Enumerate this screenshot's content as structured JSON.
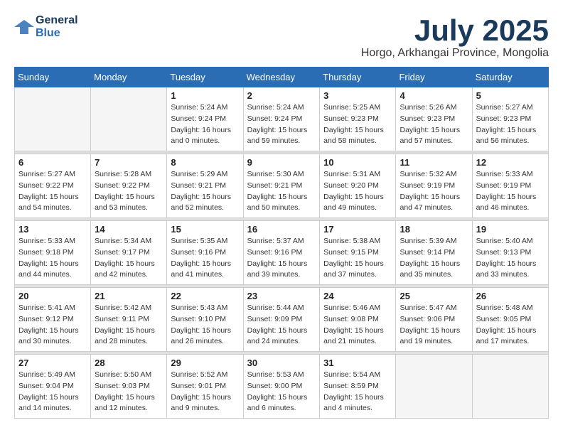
{
  "logo": {
    "line1": "General",
    "line2": "Blue"
  },
  "title": "July 2025",
  "location": "Horgo, Arkhangai Province, Mongolia",
  "days_of_week": [
    "Sunday",
    "Monday",
    "Tuesday",
    "Wednesday",
    "Thursday",
    "Friday",
    "Saturday"
  ],
  "weeks": [
    [
      {
        "day": "",
        "sunrise": "",
        "sunset": "",
        "daylight": ""
      },
      {
        "day": "",
        "sunrise": "",
        "sunset": "",
        "daylight": ""
      },
      {
        "day": "1",
        "sunrise": "Sunrise: 5:24 AM",
        "sunset": "Sunset: 9:24 PM",
        "daylight": "Daylight: 16 hours and 0 minutes."
      },
      {
        "day": "2",
        "sunrise": "Sunrise: 5:24 AM",
        "sunset": "Sunset: 9:24 PM",
        "daylight": "Daylight: 15 hours and 59 minutes."
      },
      {
        "day": "3",
        "sunrise": "Sunrise: 5:25 AM",
        "sunset": "Sunset: 9:23 PM",
        "daylight": "Daylight: 15 hours and 58 minutes."
      },
      {
        "day": "4",
        "sunrise": "Sunrise: 5:26 AM",
        "sunset": "Sunset: 9:23 PM",
        "daylight": "Daylight: 15 hours and 57 minutes."
      },
      {
        "day": "5",
        "sunrise": "Sunrise: 5:27 AM",
        "sunset": "Sunset: 9:23 PM",
        "daylight": "Daylight: 15 hours and 56 minutes."
      }
    ],
    [
      {
        "day": "6",
        "sunrise": "Sunrise: 5:27 AM",
        "sunset": "Sunset: 9:22 PM",
        "daylight": "Daylight: 15 hours and 54 minutes."
      },
      {
        "day": "7",
        "sunrise": "Sunrise: 5:28 AM",
        "sunset": "Sunset: 9:22 PM",
        "daylight": "Daylight: 15 hours and 53 minutes."
      },
      {
        "day": "8",
        "sunrise": "Sunrise: 5:29 AM",
        "sunset": "Sunset: 9:21 PM",
        "daylight": "Daylight: 15 hours and 52 minutes."
      },
      {
        "day": "9",
        "sunrise": "Sunrise: 5:30 AM",
        "sunset": "Sunset: 9:21 PM",
        "daylight": "Daylight: 15 hours and 50 minutes."
      },
      {
        "day": "10",
        "sunrise": "Sunrise: 5:31 AM",
        "sunset": "Sunset: 9:20 PM",
        "daylight": "Daylight: 15 hours and 49 minutes."
      },
      {
        "day": "11",
        "sunrise": "Sunrise: 5:32 AM",
        "sunset": "Sunset: 9:19 PM",
        "daylight": "Daylight: 15 hours and 47 minutes."
      },
      {
        "day": "12",
        "sunrise": "Sunrise: 5:33 AM",
        "sunset": "Sunset: 9:19 PM",
        "daylight": "Daylight: 15 hours and 46 minutes."
      }
    ],
    [
      {
        "day": "13",
        "sunrise": "Sunrise: 5:33 AM",
        "sunset": "Sunset: 9:18 PM",
        "daylight": "Daylight: 15 hours and 44 minutes."
      },
      {
        "day": "14",
        "sunrise": "Sunrise: 5:34 AM",
        "sunset": "Sunset: 9:17 PM",
        "daylight": "Daylight: 15 hours and 42 minutes."
      },
      {
        "day": "15",
        "sunrise": "Sunrise: 5:35 AM",
        "sunset": "Sunset: 9:16 PM",
        "daylight": "Daylight: 15 hours and 41 minutes."
      },
      {
        "day": "16",
        "sunrise": "Sunrise: 5:37 AM",
        "sunset": "Sunset: 9:16 PM",
        "daylight": "Daylight: 15 hours and 39 minutes."
      },
      {
        "day": "17",
        "sunrise": "Sunrise: 5:38 AM",
        "sunset": "Sunset: 9:15 PM",
        "daylight": "Daylight: 15 hours and 37 minutes."
      },
      {
        "day": "18",
        "sunrise": "Sunrise: 5:39 AM",
        "sunset": "Sunset: 9:14 PM",
        "daylight": "Daylight: 15 hours and 35 minutes."
      },
      {
        "day": "19",
        "sunrise": "Sunrise: 5:40 AM",
        "sunset": "Sunset: 9:13 PM",
        "daylight": "Daylight: 15 hours and 33 minutes."
      }
    ],
    [
      {
        "day": "20",
        "sunrise": "Sunrise: 5:41 AM",
        "sunset": "Sunset: 9:12 PM",
        "daylight": "Daylight: 15 hours and 30 minutes."
      },
      {
        "day": "21",
        "sunrise": "Sunrise: 5:42 AM",
        "sunset": "Sunset: 9:11 PM",
        "daylight": "Daylight: 15 hours and 28 minutes."
      },
      {
        "day": "22",
        "sunrise": "Sunrise: 5:43 AM",
        "sunset": "Sunset: 9:10 PM",
        "daylight": "Daylight: 15 hours and 26 minutes."
      },
      {
        "day": "23",
        "sunrise": "Sunrise: 5:44 AM",
        "sunset": "Sunset: 9:09 PM",
        "daylight": "Daylight: 15 hours and 24 minutes."
      },
      {
        "day": "24",
        "sunrise": "Sunrise: 5:46 AM",
        "sunset": "Sunset: 9:08 PM",
        "daylight": "Daylight: 15 hours and 21 minutes."
      },
      {
        "day": "25",
        "sunrise": "Sunrise: 5:47 AM",
        "sunset": "Sunset: 9:06 PM",
        "daylight": "Daylight: 15 hours and 19 minutes."
      },
      {
        "day": "26",
        "sunrise": "Sunrise: 5:48 AM",
        "sunset": "Sunset: 9:05 PM",
        "daylight": "Daylight: 15 hours and 17 minutes."
      }
    ],
    [
      {
        "day": "27",
        "sunrise": "Sunrise: 5:49 AM",
        "sunset": "Sunset: 9:04 PM",
        "daylight": "Daylight: 15 hours and 14 minutes."
      },
      {
        "day": "28",
        "sunrise": "Sunrise: 5:50 AM",
        "sunset": "Sunset: 9:03 PM",
        "daylight": "Daylight: 15 hours and 12 minutes."
      },
      {
        "day": "29",
        "sunrise": "Sunrise: 5:52 AM",
        "sunset": "Sunset: 9:01 PM",
        "daylight": "Daylight: 15 hours and 9 minutes."
      },
      {
        "day": "30",
        "sunrise": "Sunrise: 5:53 AM",
        "sunset": "Sunset: 9:00 PM",
        "daylight": "Daylight: 15 hours and 6 minutes."
      },
      {
        "day": "31",
        "sunrise": "Sunrise: 5:54 AM",
        "sunset": "Sunset: 8:59 PM",
        "daylight": "Daylight: 15 hours and 4 minutes."
      },
      {
        "day": "",
        "sunrise": "",
        "sunset": "",
        "daylight": ""
      },
      {
        "day": "",
        "sunrise": "",
        "sunset": "",
        "daylight": ""
      }
    ]
  ]
}
